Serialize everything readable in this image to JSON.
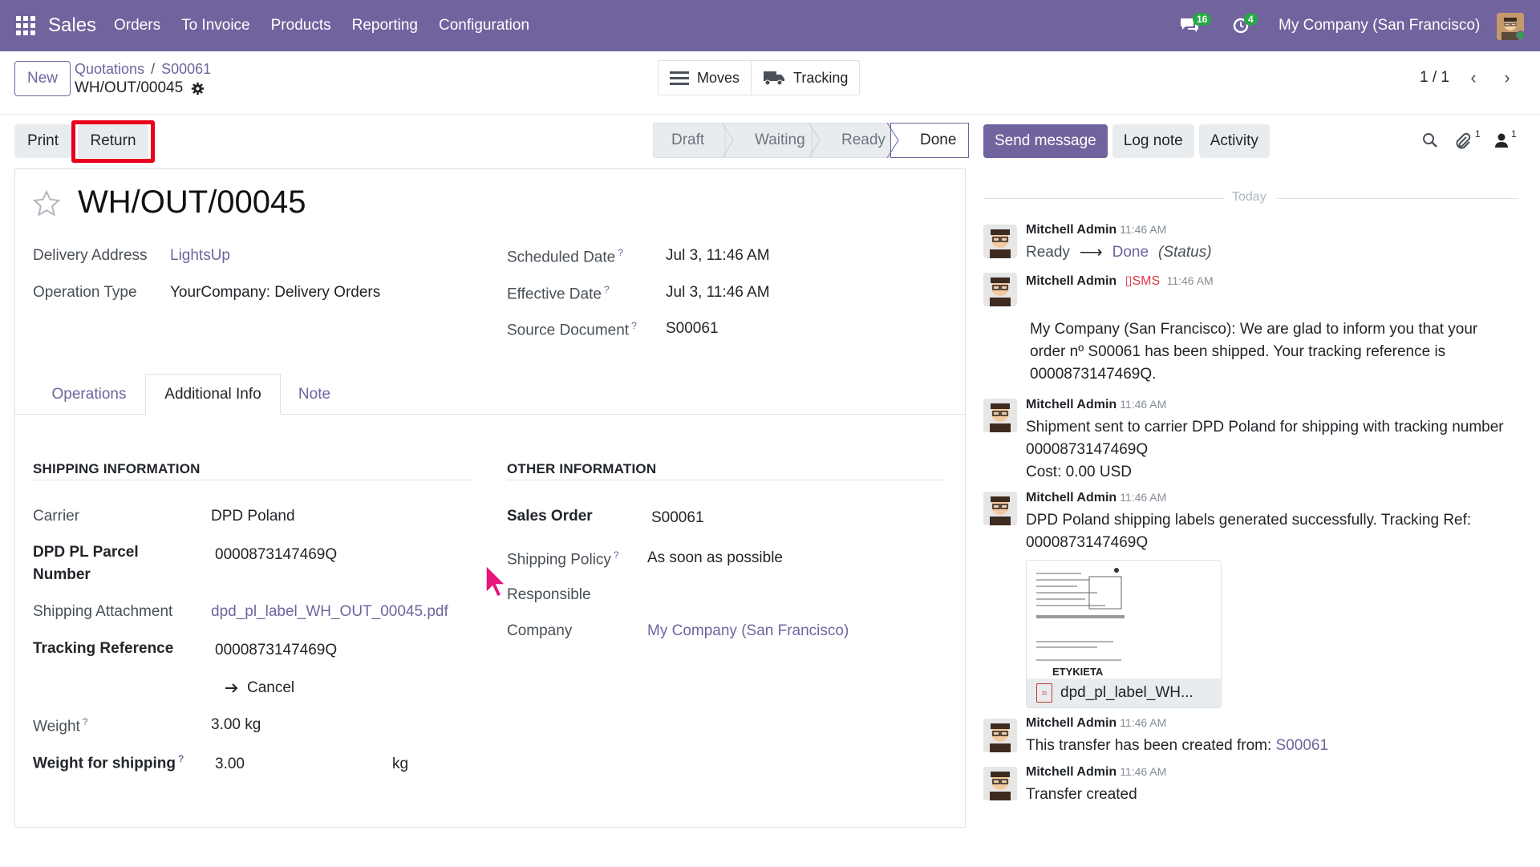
{
  "topbar": {
    "app_name": "Sales",
    "menu": [
      "Orders",
      "To Invoice",
      "Products",
      "Reporting",
      "Configuration"
    ],
    "messages_count": "16",
    "activities_count": "4",
    "company": "My Company (San Francisco)"
  },
  "control": {
    "new_label": "New",
    "breadcrumb": [
      "Quotations",
      "S00061"
    ],
    "record_name": "WH/OUT/00045",
    "smart_buttons": [
      "Moves",
      "Tracking"
    ],
    "pager": "1 / 1"
  },
  "actions": {
    "print_label": "Print",
    "return_label": "Return"
  },
  "statusbar": {
    "stages": [
      "Draft",
      "Waiting",
      "Ready",
      "Done"
    ],
    "current": "Done"
  },
  "chatter_buttons": {
    "send_message": "Send message",
    "log_note": "Log note",
    "activity": "Activity",
    "attachments_count": "1",
    "followers_count": "1"
  },
  "form": {
    "title": "WH/OUT/00045",
    "delivery_address_label": "Delivery Address",
    "delivery_address": "LightsUp",
    "operation_type_label": "Operation Type",
    "operation_type": "YourCompany: Delivery Orders",
    "scheduled_date_label": "Scheduled Date",
    "scheduled_date": "Jul 3, 11:46 AM",
    "effective_date_label": "Effective Date",
    "effective_date": "Jul 3, 11:46 AM",
    "source_document_label": "Source Document",
    "source_document": "S00061",
    "help_mark": "?"
  },
  "tabs": [
    "Operations",
    "Additional Info",
    "Note"
  ],
  "shipping": {
    "heading": "SHIPPING INFORMATION",
    "carrier_label": "Carrier",
    "carrier": "DPD Poland",
    "parcel_label_1": "DPD PL Parcel",
    "parcel_label_2": "Number",
    "parcel_number": "0000873147469Q",
    "attachment_label": "Shipping Attachment",
    "attachment": "dpd_pl_label_WH_OUT_00045.pdf",
    "tracking_label": "Tracking Reference",
    "tracking": "0000873147469Q",
    "cancel_label": "Cancel",
    "weight_label": "Weight",
    "weight": "3.00 kg",
    "weight_shipping_label": "Weight for shipping",
    "weight_shipping": "3.00",
    "weight_unit": "kg"
  },
  "other": {
    "heading": "OTHER INFORMATION",
    "sales_order_label": "Sales Order",
    "sales_order": "S00061",
    "shipping_policy_label": "Shipping Policy",
    "shipping_policy": "As soon as possible",
    "responsible_label": "Responsible",
    "company_label": "Company",
    "company": "My Company (San Francisco)"
  },
  "chatter": {
    "today": "Today",
    "messages": [
      {
        "author": "Mitchell Admin",
        "time": "11:46 AM",
        "from": "Ready",
        "to": "Done",
        "field": "(Status)"
      },
      {
        "author": "Mitchell Admin",
        "sms": "SMS",
        "time": "11:46 AM",
        "lines": [
          "My Company (San Francisco): We are glad to inform you that your",
          "order nº S00061 has been shipped. Your tracking reference is",
          "0000873147469Q."
        ]
      },
      {
        "author": "Mitchell Admin",
        "time": "11:46 AM",
        "lines": [
          "Shipment sent to carrier DPD Poland for shipping with tracking number",
          "0000873147469Q",
          "Cost: 0.00 USD"
        ]
      },
      {
        "author": "Mitchell Admin",
        "time": "11:46 AM",
        "lines": [
          "DPD Poland shipping labels generated successfully. Tracking Ref:",
          "0000873147469Q"
        ],
        "attachment": "dpd_pl_label_WH...",
        "thumb_text": "ETYKIETA"
      },
      {
        "author": "Mitchell Admin",
        "time": "11:46 AM",
        "text": "This transfer has been created from:",
        "link": "S00061"
      },
      {
        "author": "Mitchell Admin",
        "time": "11:46 AM",
        "text": "Transfer created"
      }
    ]
  }
}
